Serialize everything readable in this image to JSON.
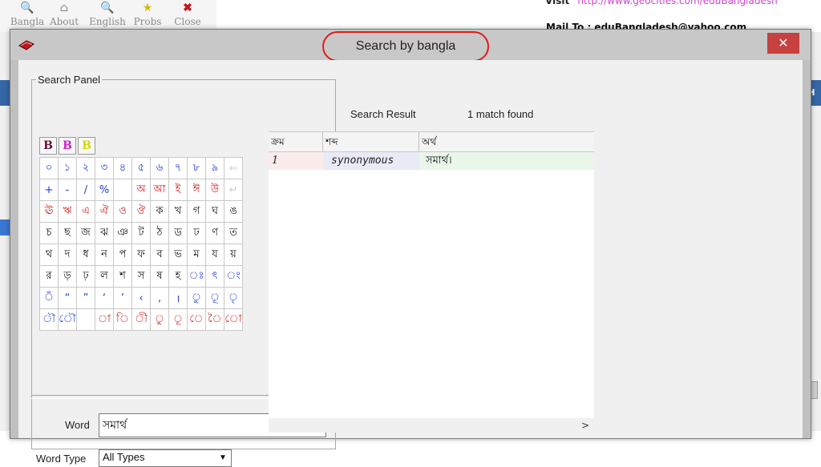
{
  "background": {
    "toolbar": [
      {
        "label": "Bangla",
        "icon": "magnifier-icon"
      },
      {
        "label": "About",
        "icon": "house-icon"
      },
      {
        "label": "English",
        "icon": "magnifier-icon"
      },
      {
        "label": "Probs",
        "icon": "star-icon"
      },
      {
        "label": "Close",
        "icon": "x-icon"
      }
    ],
    "visit_label": "Visit",
    "visit_link": "http://www.geocities.com/eduBangladesh",
    "mail_label": "Mail To : eduBangladesh@yahoo.com",
    "right_tab_text": "H"
  },
  "dialog": {
    "title": "Search by bangla",
    "close_glyph": "✕",
    "accent": "#e21a1a"
  },
  "search_panel": {
    "legend": "Search Panel",
    "style_buttons": [
      {
        "label": "B",
        "color": "#6a0a3a"
      },
      {
        "label": "B",
        "color": "#d21fd2"
      },
      {
        "label": "B",
        "color": "#d8d800"
      }
    ],
    "keyboard": [
      [
        "০",
        "১",
        "২",
        "৩",
        "৪",
        "৫",
        "৬",
        "৭",
        "৮",
        "৯",
        "⇐"
      ],
      [
        "+",
        "-",
        "/",
        "%",
        "",
        "অ",
        "আ",
        "ই",
        "ঈ",
        "উ",
        "↵"
      ],
      [
        "ঊ",
        "ঋ",
        "এ",
        "ঐ",
        "ও",
        "ঔ",
        "ক",
        "খ",
        "গ",
        "ঘ",
        "ঙ"
      ],
      [
        "চ",
        "ছ",
        "জ",
        "ঝ",
        "ঞ",
        "ট",
        "ঠ",
        "ড",
        "ঢ",
        "ণ",
        "ত"
      ],
      [
        "থ",
        "দ",
        "ধ",
        "ন",
        "প",
        "ফ",
        "ব",
        "ভ",
        "ম",
        "য",
        "য়"
      ],
      [
        "র",
        "ড়",
        "ঢ়",
        "ল",
        "শ",
        "স",
        "ষ",
        "হ",
        "ঃ",
        "ৎ",
        "ং"
      ],
      [
        "ঁ",
        "“",
        "”",
        "‘",
        "’",
        "‹",
        "‚",
        "।",
        "ু",
        "ূ",
        "ৃ"
      ],
      [
        "ৗ",
        "ৌ",
        "",
        "া",
        "ি",
        "ী",
        "ু",
        "ূ",
        "ে",
        "ৈ",
        "ো"
      ]
    ],
    "keyboard_colors": [
      [
        "blue",
        "blue",
        "blue",
        "blue",
        "blue",
        "blue",
        "blue",
        "blue",
        "blue",
        "blue",
        "gray"
      ],
      [
        "blue",
        "blue",
        "blue",
        "blue",
        "blue",
        "red",
        "red",
        "red",
        "red",
        "red",
        "gray"
      ],
      [
        "red",
        "red",
        "red",
        "red",
        "red",
        "red",
        "black",
        "black",
        "black",
        "black",
        "black"
      ],
      [
        "black",
        "black",
        "black",
        "black",
        "black",
        "black",
        "black",
        "black",
        "black",
        "black",
        "black"
      ],
      [
        "black",
        "black",
        "black",
        "black",
        "black",
        "black",
        "black",
        "black",
        "black",
        "black",
        "black"
      ],
      [
        "black",
        "black",
        "black",
        "black",
        "black",
        "black",
        "black",
        "black",
        "blue",
        "blue",
        "blue"
      ],
      [
        "blue",
        "blue",
        "blue",
        "blue",
        "blue",
        "blue",
        "blue",
        "blue",
        "blue",
        "blue",
        "blue"
      ],
      [
        "blue",
        "blue",
        "blue",
        "red",
        "red",
        "red",
        "red",
        "red",
        "red",
        "red",
        "red"
      ]
    ],
    "word_label": "Word",
    "word_value": "সমার্থ",
    "word_type_label": "Word Type",
    "word_type_value": "All Types"
  },
  "results": {
    "label": "Search Result",
    "count": "1 match found",
    "columns": [
      "ক্রম",
      "শব্দ",
      "অর্থ"
    ],
    "rows": [
      {
        "num": "1",
        "word": "synonymous",
        "meaning": "সমার্থ।"
      }
    ],
    "scroll_right_glyph": ">"
  }
}
